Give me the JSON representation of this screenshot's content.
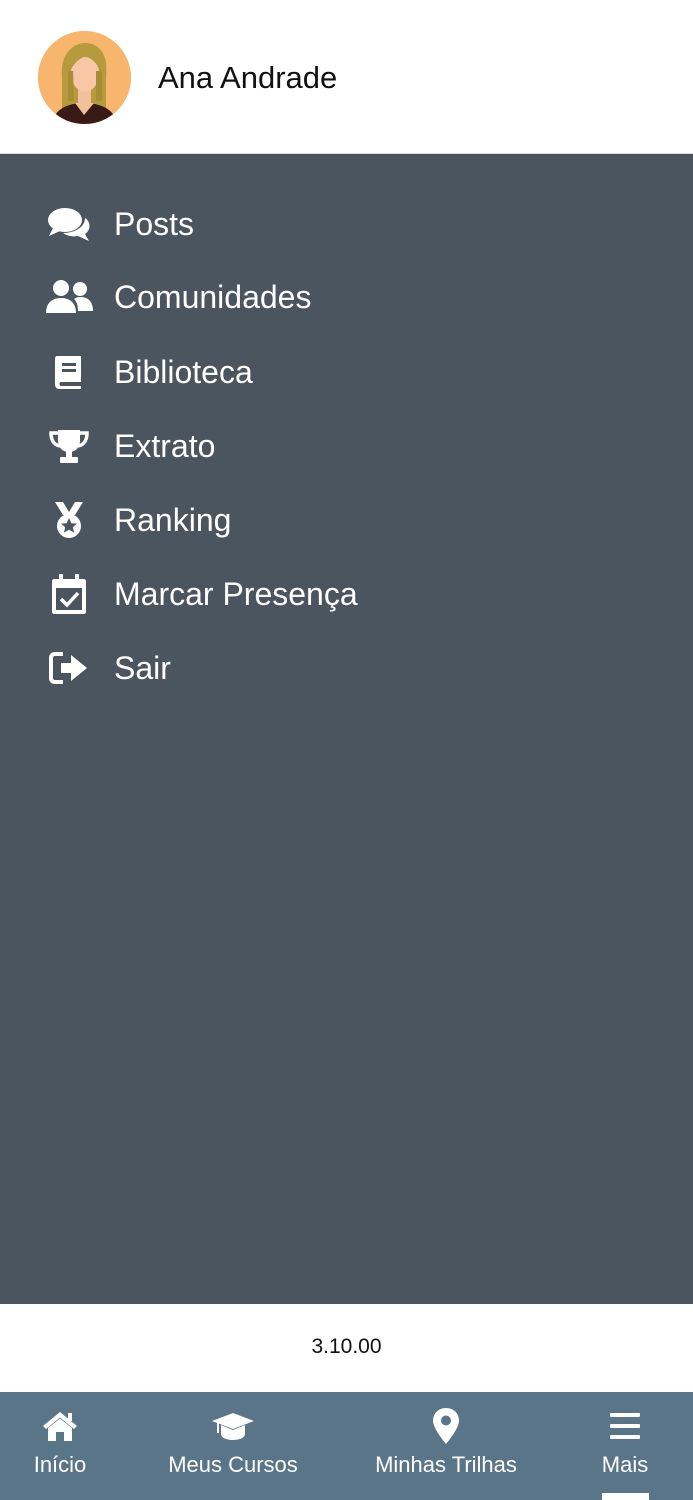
{
  "user": {
    "name": "Ana Andrade"
  },
  "menu": {
    "items": [
      {
        "label": "Posts",
        "icon": "comments-icon"
      },
      {
        "label": "Comunidades",
        "icon": "users-icon"
      },
      {
        "label": "Biblioteca",
        "icon": "book-icon"
      },
      {
        "label": "Extrato",
        "icon": "trophy-icon"
      },
      {
        "label": "Ranking",
        "icon": "medal-icon"
      },
      {
        "label": "Marcar Presença",
        "icon": "calendar-check-icon"
      },
      {
        "label": "Sair",
        "icon": "sign-out-icon"
      }
    ]
  },
  "footer": {
    "version": "3.10.00"
  },
  "bottom_nav": {
    "items": [
      {
        "label": "Início",
        "icon": "home-icon"
      },
      {
        "label": "Meus Cursos",
        "icon": "graduation-cap-icon"
      },
      {
        "label": "Minhas Trilhas",
        "icon": "map-marker-icon"
      },
      {
        "label": "Mais",
        "icon": "menu-icon",
        "active": true
      }
    ]
  },
  "colors": {
    "menu_background": "#4a5560",
    "bottom_nav_background": "#5a7488",
    "avatar_background": "#f7b56e",
    "text_on_dark": "#ffffff"
  }
}
